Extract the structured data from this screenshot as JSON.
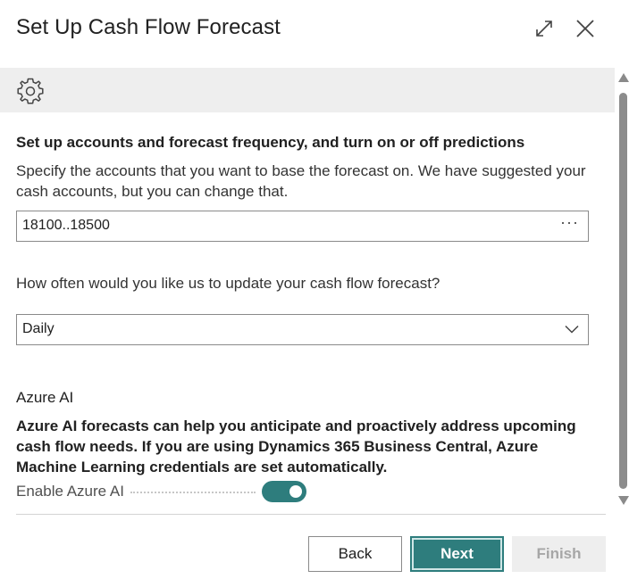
{
  "dialog": {
    "title": "Set Up Cash Flow Forecast"
  },
  "section": {
    "heading": "Set up accounts and forecast frequency, and turn on or off predictions",
    "description": "Specify the accounts that you want to base the forecast on. We have suggested your cash accounts, but you can change that.",
    "accounts_value": "18100..18500",
    "accounts_lookup": "···",
    "frequency_question": "How often would you like us to update your cash flow forecast?",
    "frequency_value": "Daily"
  },
  "azure": {
    "heading": "Azure AI",
    "description": "Azure AI forecasts can help you anticipate and proactively address upcoming cash flow needs. If you are using Dynamics 365 Business Central, Azure Machine Learning credentials are set automatically.",
    "toggle_label": "Enable Azure AI",
    "enabled": true
  },
  "footer": {
    "back_label": "Back",
    "next_label": "Next",
    "finish_label": "Finish"
  },
  "icons": {
    "expand": "expand-icon",
    "close": "close-icon",
    "settings": "gear-icon",
    "dropdown": "chevron-down-icon"
  },
  "colors": {
    "accent": "#2e7d7d",
    "banner": "#eeeeee"
  }
}
